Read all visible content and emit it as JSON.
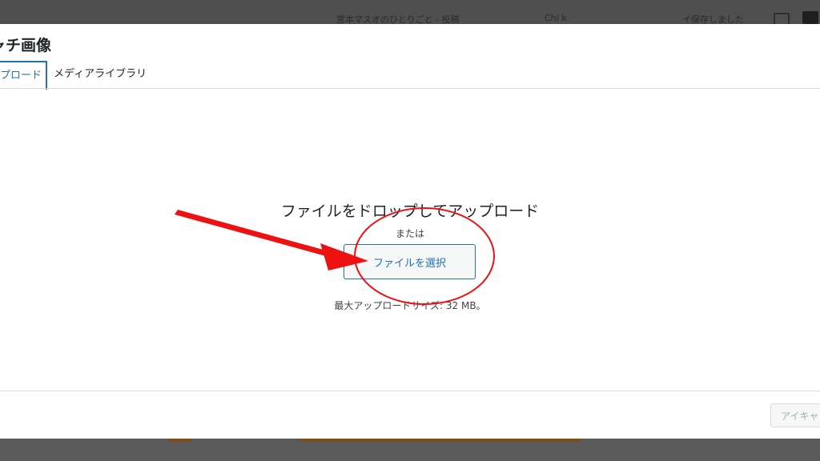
{
  "background_editor": {
    "post_title_partial": "宮本マスオのひとりごと - 投稿",
    "status_partial": "Chi k",
    "label_partial": "イ保存しました"
  },
  "modal": {
    "title": "ャチ画像",
    "tabs": [
      {
        "label": "プロード",
        "active": true
      },
      {
        "label": "メディアライブラリ",
        "active": false
      }
    ],
    "upload": {
      "drop_text": "ファイルをドロップしてアップロード",
      "or_text": "または",
      "select_button": "ファイルを選択",
      "max_size": "最大アップロードサイズ: 32 MB。"
    },
    "footer": {
      "set_button": "アイキャ"
    }
  },
  "annotations": {
    "arrow_color": "#ee1111",
    "circle_color": "#ee1111"
  },
  "colors": {
    "accent": "#2271b1",
    "text": "#1d2327",
    "border": "#dcdcde"
  }
}
